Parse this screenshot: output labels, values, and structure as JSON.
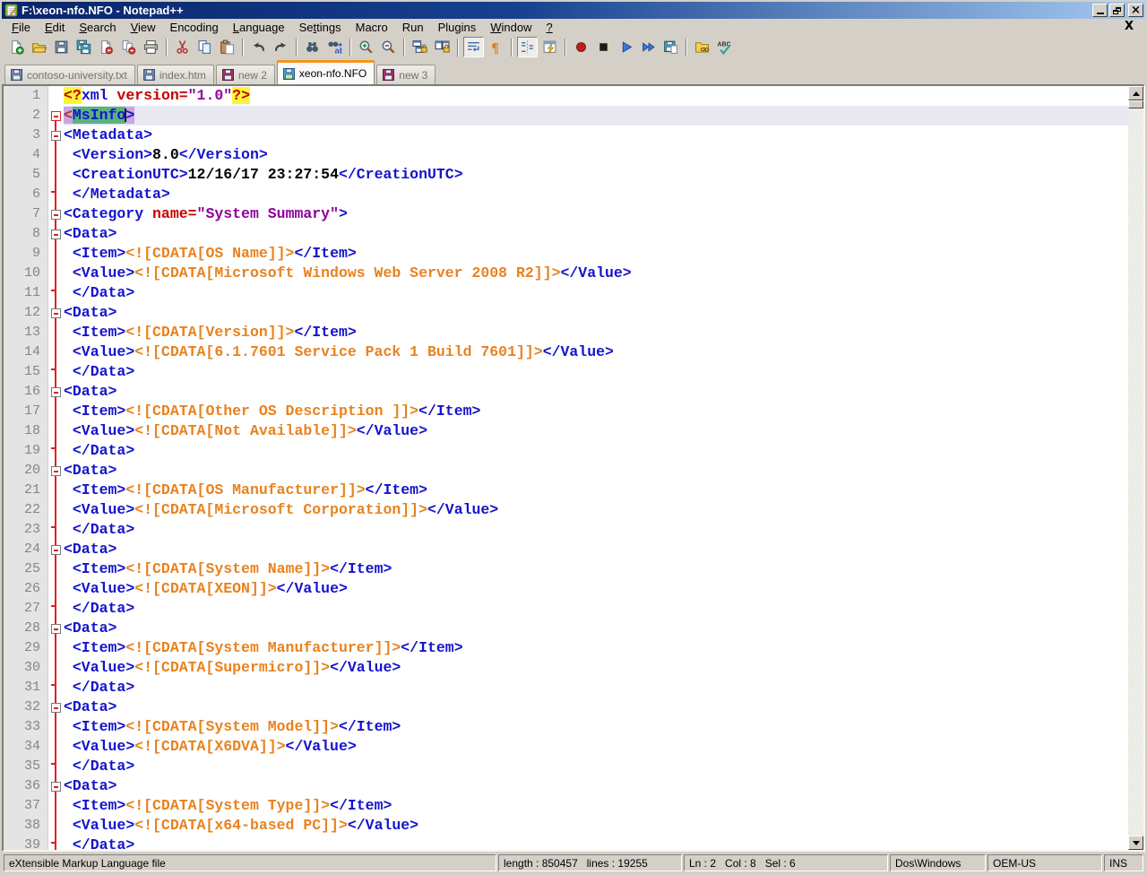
{
  "window": {
    "title": "F:\\xeon-nfo.NFO - Notepad++"
  },
  "titlebar_buttons": {
    "minimize": "minimize",
    "restore": "restore",
    "close": "close"
  },
  "menubar": {
    "close_label": "X",
    "items": [
      {
        "label": "File",
        "u": 0
      },
      {
        "label": "Edit",
        "u": 0
      },
      {
        "label": "Search",
        "u": 0
      },
      {
        "label": "View",
        "u": 0
      },
      {
        "label": "Encoding",
        "u": -1
      },
      {
        "label": "Language",
        "u": 0
      },
      {
        "label": "Settings",
        "u": 2
      },
      {
        "label": "Macro",
        "u": -1
      },
      {
        "label": "Run",
        "u": -1
      },
      {
        "label": "Plugins",
        "u": -1
      },
      {
        "label": "Window",
        "u": 0
      },
      {
        "label": "?",
        "u": 0
      }
    ]
  },
  "toolbar": {
    "buttons": [
      "new-file",
      "open-file",
      "save",
      "save-all",
      "close",
      "close-all",
      "print",
      "|",
      "cut",
      "copy",
      "paste",
      "|",
      "undo",
      "redo",
      "|",
      "find",
      "replace",
      "|",
      "zoom-in",
      "zoom-out",
      "|",
      "sync-vertical-scroll",
      "sync-horizontal-scroll",
      "|",
      "word-wrap",
      "show-all-characters",
      "|",
      "show-indent-guide",
      "function-list",
      "|",
      "macro-record",
      "macro-stop",
      "macro-play",
      "macro-run-multiple",
      "macro-save",
      "|",
      "open-containing-folder",
      "spell-check"
    ],
    "pressed": [
      "word-wrap",
      "show-indent-guide"
    ]
  },
  "tabs": [
    {
      "label": "contoso-university.txt",
      "state": "inactive",
      "modified": false
    },
    {
      "label": "index.htm",
      "state": "inactive",
      "modified": false
    },
    {
      "label": "new 2",
      "state": "inactive",
      "modified": true
    },
    {
      "label": "xeon-nfo.NFO",
      "state": "active",
      "modified": false
    },
    {
      "label": "new 3",
      "state": "inactive",
      "modified": true
    }
  ],
  "colors": {
    "chrome": "#D4D0C8",
    "accent": "#F7941D",
    "titleL": "#0A246A",
    "titleR": "#A6CAF0",
    "tag": "#1414CC",
    "attr": "#C80000",
    "str": "#90009C",
    "cdata": "#E8821E",
    "pi": "#C80000",
    "piBg": "#FBF53B",
    "val": "#000000",
    "sel": "#58B47E",
    "match": "#C9A6E0",
    "cline": "#E8E8F2",
    "foldline": "#E02020",
    "numFg": "#858585",
    "numBg": "#E4E4E4"
  },
  "editor": {
    "caret": {
      "line": 2,
      "col": 8,
      "sel": 6
    },
    "lines": [
      {
        "num": 1,
        "fold": "none",
        "tokens": [
          {
            "t": "<?",
            "s": "pi"
          },
          {
            "t": "xml",
            "s": "tag"
          },
          {
            "t": " version=",
            "s": "attr"
          },
          {
            "t": "\"1.0\"",
            "s": "str"
          },
          {
            "t": "?>",
            "s": "pi"
          }
        ]
      },
      {
        "num": 2,
        "fold": "first",
        "cur": true,
        "tokens": [
          {
            "t": "<",
            "s": "mlt"
          },
          {
            "t": "MsInfo",
            "s": "msel",
            "caret": true
          },
          {
            "t": ">",
            "s": "mgt"
          }
        ]
      },
      {
        "num": 3,
        "fold": "open",
        "tokens": [
          {
            "t": "<Metadata>",
            "s": "tag"
          }
        ]
      },
      {
        "num": 4,
        "fold": "line",
        "tokens": [
          {
            "t": " ",
            "s": "pl"
          },
          {
            "t": "<Version>",
            "s": "tag"
          },
          {
            "t": "8.0",
            "s": "val"
          },
          {
            "t": "</Version>",
            "s": "tag"
          }
        ]
      },
      {
        "num": 5,
        "fold": "line",
        "tokens": [
          {
            "t": " ",
            "s": "pl"
          },
          {
            "t": "<CreationUTC>",
            "s": "tag"
          },
          {
            "t": "12/16/17 23:27:54",
            "s": "val"
          },
          {
            "t": "</CreationUTC>",
            "s": "tag"
          }
        ]
      },
      {
        "num": 6,
        "fold": "end",
        "tokens": [
          {
            "t": " ",
            "s": "pl"
          },
          {
            "t": "</Metadata>",
            "s": "tag"
          }
        ]
      },
      {
        "num": 7,
        "fold": "open",
        "tokens": [
          {
            "t": "<Category",
            "s": "tag"
          },
          {
            "t": " name=",
            "s": "attr"
          },
          {
            "t": "\"System Summary\"",
            "s": "str"
          },
          {
            "t": ">",
            "s": "tag"
          }
        ]
      },
      {
        "num": 8,
        "fold": "open",
        "tokens": [
          {
            "t": "<Data>",
            "s": "tag"
          }
        ]
      },
      {
        "num": 9,
        "fold": "line",
        "tokens": [
          {
            "t": " ",
            "s": "pl"
          },
          {
            "t": "<Item>",
            "s": "tag"
          },
          {
            "t": "<![CDATA[OS Name]]>",
            "s": "cd"
          },
          {
            "t": "</Item>",
            "s": "tag"
          }
        ]
      },
      {
        "num": 10,
        "fold": "line",
        "tokens": [
          {
            "t": " ",
            "s": "pl"
          },
          {
            "t": "<Value>",
            "s": "tag"
          },
          {
            "t": "<![CDATA[Microsoft Windows Web Server 2008 R2]]>",
            "s": "cd"
          },
          {
            "t": "</Value>",
            "s": "tag"
          }
        ]
      },
      {
        "num": 11,
        "fold": "end",
        "tokens": [
          {
            "t": " ",
            "s": "pl"
          },
          {
            "t": "</Data>",
            "s": "tag"
          }
        ]
      },
      {
        "num": 12,
        "fold": "open",
        "tokens": [
          {
            "t": "<Data>",
            "s": "tag"
          }
        ]
      },
      {
        "num": 13,
        "fold": "line",
        "tokens": [
          {
            "t": " ",
            "s": "pl"
          },
          {
            "t": "<Item>",
            "s": "tag"
          },
          {
            "t": "<![CDATA[Version]]>",
            "s": "cd"
          },
          {
            "t": "</Item>",
            "s": "tag"
          }
        ]
      },
      {
        "num": 14,
        "fold": "line",
        "tokens": [
          {
            "t": " ",
            "s": "pl"
          },
          {
            "t": "<Value>",
            "s": "tag"
          },
          {
            "t": "<![CDATA[6.1.7601 Service Pack 1 Build 7601]]>",
            "s": "cd"
          },
          {
            "t": "</Value>",
            "s": "tag"
          }
        ]
      },
      {
        "num": 15,
        "fold": "end",
        "tokens": [
          {
            "t": " ",
            "s": "pl"
          },
          {
            "t": "</Data>",
            "s": "tag"
          }
        ]
      },
      {
        "num": 16,
        "fold": "open",
        "tokens": [
          {
            "t": "<Data>",
            "s": "tag"
          }
        ]
      },
      {
        "num": 17,
        "fold": "line",
        "tokens": [
          {
            "t": " ",
            "s": "pl"
          },
          {
            "t": "<Item>",
            "s": "tag"
          },
          {
            "t": "<![CDATA[Other OS Description ]]>",
            "s": "cd"
          },
          {
            "t": "</Item>",
            "s": "tag"
          }
        ]
      },
      {
        "num": 18,
        "fold": "line",
        "tokens": [
          {
            "t": " ",
            "s": "pl"
          },
          {
            "t": "<Value>",
            "s": "tag"
          },
          {
            "t": "<![CDATA[Not Available]]>",
            "s": "cd"
          },
          {
            "t": "</Value>",
            "s": "tag"
          }
        ]
      },
      {
        "num": 19,
        "fold": "end",
        "tokens": [
          {
            "t": " ",
            "s": "pl"
          },
          {
            "t": "</Data>",
            "s": "tag"
          }
        ]
      },
      {
        "num": 20,
        "fold": "open",
        "tokens": [
          {
            "t": "<Data>",
            "s": "tag"
          }
        ]
      },
      {
        "num": 21,
        "fold": "line",
        "tokens": [
          {
            "t": " ",
            "s": "pl"
          },
          {
            "t": "<Item>",
            "s": "tag"
          },
          {
            "t": "<![CDATA[OS Manufacturer]]>",
            "s": "cd"
          },
          {
            "t": "</Item>",
            "s": "tag"
          }
        ]
      },
      {
        "num": 22,
        "fold": "line",
        "tokens": [
          {
            "t": " ",
            "s": "pl"
          },
          {
            "t": "<Value>",
            "s": "tag"
          },
          {
            "t": "<![CDATA[Microsoft Corporation]]>",
            "s": "cd"
          },
          {
            "t": "</Value>",
            "s": "tag"
          }
        ]
      },
      {
        "num": 23,
        "fold": "end",
        "tokens": [
          {
            "t": " ",
            "s": "pl"
          },
          {
            "t": "</Data>",
            "s": "tag"
          }
        ]
      },
      {
        "num": 24,
        "fold": "open",
        "tokens": [
          {
            "t": "<Data>",
            "s": "tag"
          }
        ]
      },
      {
        "num": 25,
        "fold": "line",
        "tokens": [
          {
            "t": " ",
            "s": "pl"
          },
          {
            "t": "<Item>",
            "s": "tag"
          },
          {
            "t": "<![CDATA[System Name]]>",
            "s": "cd"
          },
          {
            "t": "</Item>",
            "s": "tag"
          }
        ]
      },
      {
        "num": 26,
        "fold": "line",
        "tokens": [
          {
            "t": " ",
            "s": "pl"
          },
          {
            "t": "<Value>",
            "s": "tag"
          },
          {
            "t": "<![CDATA[XEON]]>",
            "s": "cd"
          },
          {
            "t": "</Value>",
            "s": "tag"
          }
        ]
      },
      {
        "num": 27,
        "fold": "end",
        "tokens": [
          {
            "t": " ",
            "s": "pl"
          },
          {
            "t": "</Data>",
            "s": "tag"
          }
        ]
      },
      {
        "num": 28,
        "fold": "open",
        "tokens": [
          {
            "t": "<Data>",
            "s": "tag"
          }
        ]
      },
      {
        "num": 29,
        "fold": "line",
        "tokens": [
          {
            "t": " ",
            "s": "pl"
          },
          {
            "t": "<Item>",
            "s": "tag"
          },
          {
            "t": "<![CDATA[System Manufacturer]]>",
            "s": "cd"
          },
          {
            "t": "</Item>",
            "s": "tag"
          }
        ]
      },
      {
        "num": 30,
        "fold": "line",
        "tokens": [
          {
            "t": " ",
            "s": "pl"
          },
          {
            "t": "<Value>",
            "s": "tag"
          },
          {
            "t": "<![CDATA[Supermicro]]>",
            "s": "cd"
          },
          {
            "t": "</Value>",
            "s": "tag"
          }
        ]
      },
      {
        "num": 31,
        "fold": "end",
        "tokens": [
          {
            "t": " ",
            "s": "pl"
          },
          {
            "t": "</Data>",
            "s": "tag"
          }
        ]
      },
      {
        "num": 32,
        "fold": "open",
        "tokens": [
          {
            "t": "<Data>",
            "s": "tag"
          }
        ]
      },
      {
        "num": 33,
        "fold": "line",
        "tokens": [
          {
            "t": " ",
            "s": "pl"
          },
          {
            "t": "<Item>",
            "s": "tag"
          },
          {
            "t": "<![CDATA[System Model]]>",
            "s": "cd"
          },
          {
            "t": "</Item>",
            "s": "tag"
          }
        ]
      },
      {
        "num": 34,
        "fold": "line",
        "tokens": [
          {
            "t": " ",
            "s": "pl"
          },
          {
            "t": "<Value>",
            "s": "tag"
          },
          {
            "t": "<![CDATA[X6DVA]]>",
            "s": "cd"
          },
          {
            "t": "</Value>",
            "s": "tag"
          }
        ]
      },
      {
        "num": 35,
        "fold": "end",
        "tokens": [
          {
            "t": " ",
            "s": "pl"
          },
          {
            "t": "</Data>",
            "s": "tag"
          }
        ]
      },
      {
        "num": 36,
        "fold": "open",
        "tokens": [
          {
            "t": "<Data>",
            "s": "tag"
          }
        ]
      },
      {
        "num": 37,
        "fold": "line",
        "tokens": [
          {
            "t": " ",
            "s": "pl"
          },
          {
            "t": "<Item>",
            "s": "tag"
          },
          {
            "t": "<![CDATA[System Type]]>",
            "s": "cd"
          },
          {
            "t": "</Item>",
            "s": "tag"
          }
        ]
      },
      {
        "num": 38,
        "fold": "line",
        "tokens": [
          {
            "t": " ",
            "s": "pl"
          },
          {
            "t": "<Value>",
            "s": "tag"
          },
          {
            "t": "<![CDATA[x64-based PC]]>",
            "s": "cd"
          },
          {
            "t": "</Value>",
            "s": "tag"
          }
        ]
      },
      {
        "num": 39,
        "fold": "end",
        "tokens": [
          {
            "t": " ",
            "s": "pl"
          },
          {
            "t": "</Data>",
            "s": "tag"
          }
        ]
      }
    ]
  },
  "statusbar": {
    "doc_type": "eXtensible Markup Language file",
    "length_info": "length : 850457   lines : 19255",
    "position_info": "Ln : 2   Col : 8   Sel : 6",
    "eol_format": "Dos\\Windows",
    "encoding": "OEM-US",
    "insert_mode": "INS"
  }
}
